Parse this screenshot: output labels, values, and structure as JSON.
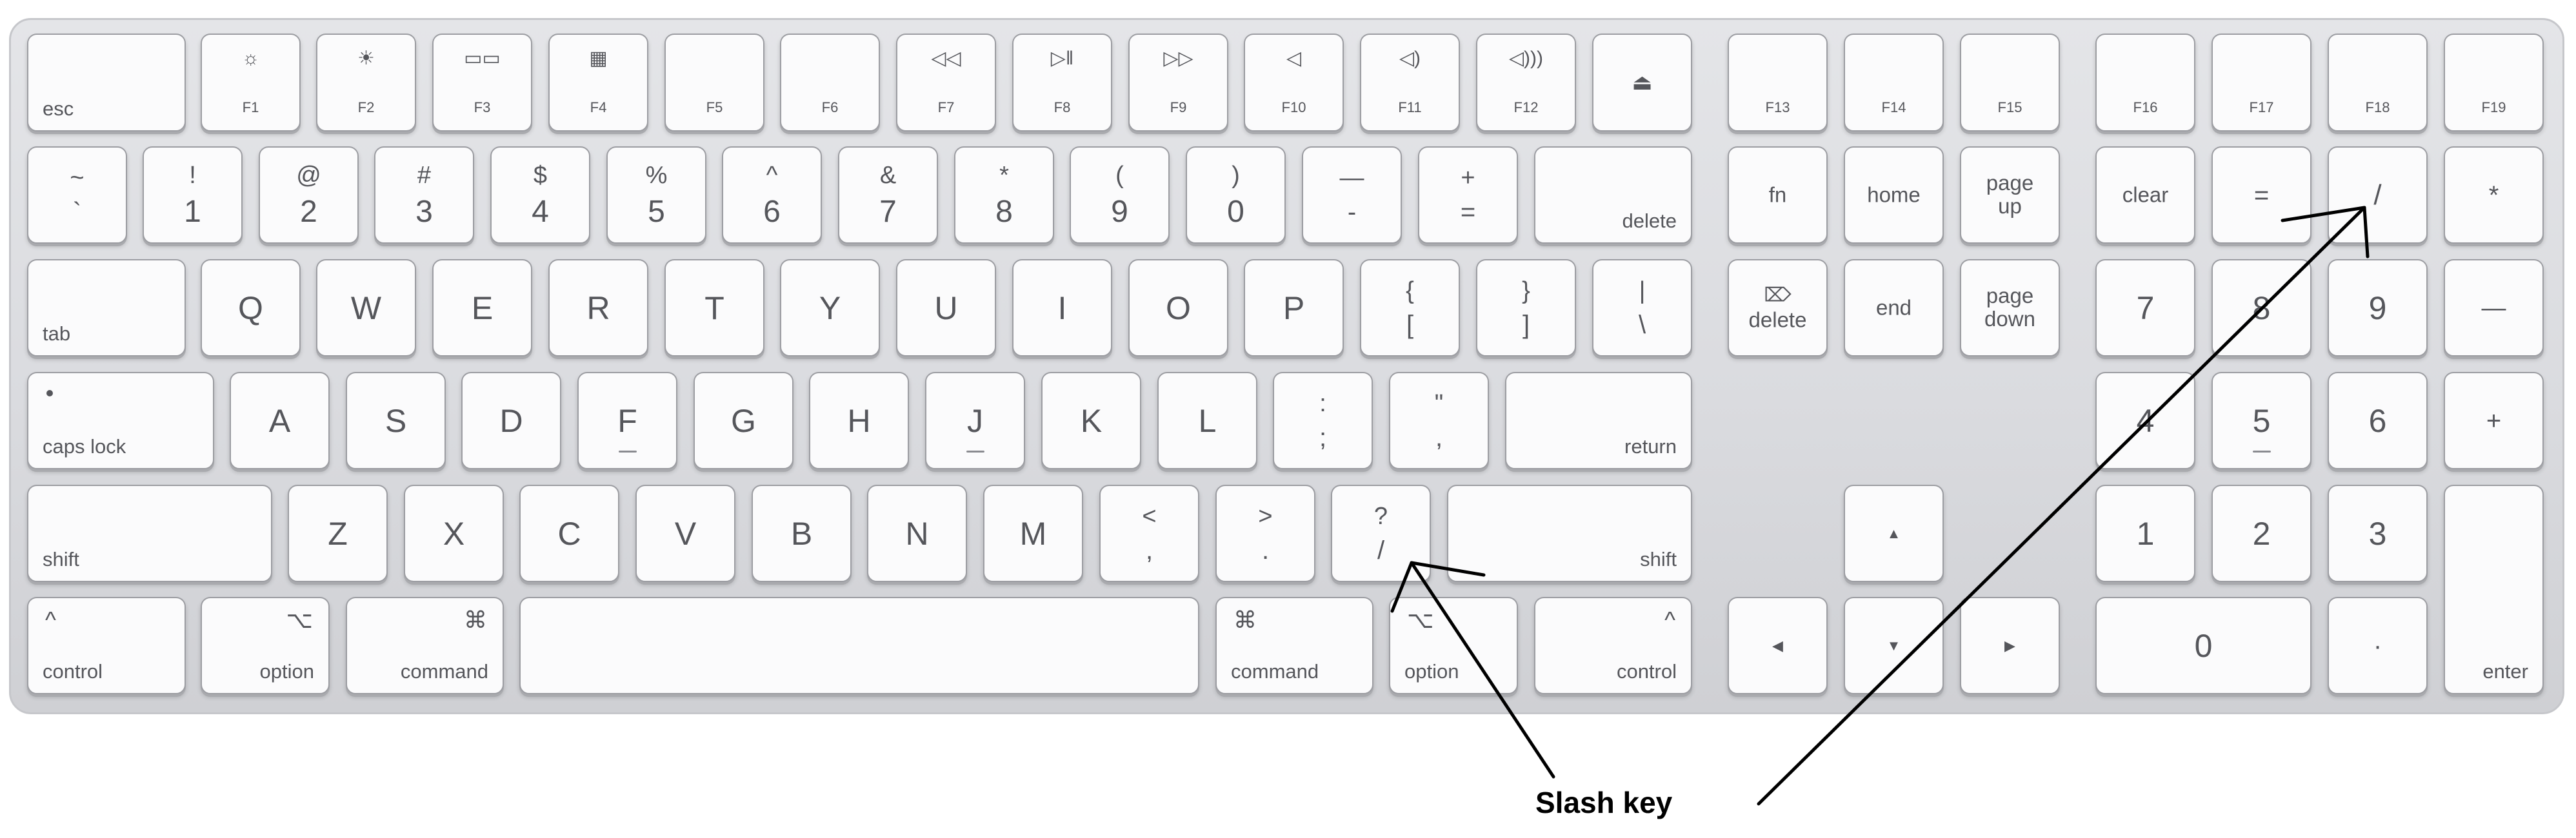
{
  "annotation": {
    "caption": "Slash key",
    "line_color": "#000000"
  },
  "colors": {
    "key_face": "#fbfbfc",
    "key_border": "#9c9da2",
    "legend": "#55565b",
    "keyboard_body": "#dcdde1"
  },
  "keys": {
    "esc": "esc",
    "f1": "F1",
    "f1_icon": "☼",
    "f2": "F2",
    "f2_icon": "☀",
    "f3": "F3",
    "f3_icon": "▭▭",
    "f4": "F4",
    "f4_icon": "▦",
    "f5": "F5",
    "f6": "F6",
    "f7": "F7",
    "f7_icon": "◁◁",
    "f8": "F8",
    "f8_icon": "▷‖",
    "f9": "F9",
    "f9_icon": "▷▷",
    "f10": "F10",
    "f10_icon": "◁",
    "f11": "F11",
    "f11_icon": "◁)",
    "f12": "F12",
    "f12_icon": "◁)))",
    "eject_icon": "⏏",
    "f13": "F13",
    "f14": "F14",
    "f15": "F15",
    "f16": "F16",
    "f17": "F17",
    "f18": "F18",
    "f19": "F19",
    "tilde_top": "~",
    "tilde_bottom": "`",
    "n1_top": "!",
    "n1": "1",
    "n2_top": "@",
    "n2": "2",
    "n3_top": "#",
    "n3": "3",
    "n4_top": "$",
    "n4": "4",
    "n5_top": "%",
    "n5": "5",
    "n6_top": "^",
    "n6": "6",
    "n7_top": "&",
    "n7": "7",
    "n8_top": "*",
    "n8": "8",
    "n9_top": "(",
    "n9": "9",
    "n0_top": ")",
    "n0": "0",
    "minus_top": "—",
    "minus": "-",
    "plus_top": "+",
    "equals": "=",
    "delete": "delete",
    "fn": "fn",
    "home": "home",
    "page_up": "page\nup",
    "clear": "clear",
    "pad_equals": "=",
    "pad_slash": "/",
    "pad_star": "*",
    "tab": "tab",
    "q": "Q",
    "w": "W",
    "e": "E",
    "r": "R",
    "t": "T",
    "y": "Y",
    "u": "U",
    "i": "I",
    "o": "O",
    "p": "P",
    "lbrace_top": "{",
    "lbrace": "[",
    "rbrace_top": "}",
    "rbrace": "]",
    "pipe_top": "|",
    "backslash": "\\",
    "fwd_delete_icon": "⌦",
    "fwd_delete": "delete",
    "end": "end",
    "page_down": "page\ndown",
    "pad7": "7",
    "pad8": "8",
    "pad9": "9",
    "pad_minus": "—",
    "caps_lock": "caps lock",
    "a": "A",
    "s": "S",
    "d": "D",
    "f": "F",
    "g": "G",
    "h": "H",
    "j": "J",
    "k": "K",
    "l": "L",
    "colon_top": ":",
    "semicolon": ";",
    "quote_top": "\"",
    "quote": ",",
    "return": "return",
    "pad4": "4",
    "pad5": "5",
    "pad6": "6",
    "pad_plus": "+",
    "shift_left": "shift",
    "z": "Z",
    "x": "X",
    "c": "C",
    "v": "V",
    "b": "B",
    "n": "N",
    "m": "M",
    "lt_top": "<",
    "comma": ",",
    "gt_top": ">",
    "period": ".",
    "question_top": "?",
    "slash": "/",
    "shift_right": "shift",
    "arrow_up_icon": "▲",
    "pad1": "1",
    "pad2": "2",
    "pad3": "3",
    "control_left_icon": "^",
    "control_left": "control",
    "option_left_icon": "⌥",
    "option_left": "option",
    "command_left_icon": "⌘",
    "command_left": "command",
    "command_right_icon": "⌘",
    "command_right": "command",
    "option_right_icon": "⌥",
    "option_right": "option",
    "control_right_icon": "^",
    "control_right": "control",
    "arrow_left_icon": "◀",
    "arrow_down_icon": "▼",
    "arrow_right_icon": "▶",
    "pad0": "0",
    "pad_dot": "·",
    "enter": "enter"
  }
}
